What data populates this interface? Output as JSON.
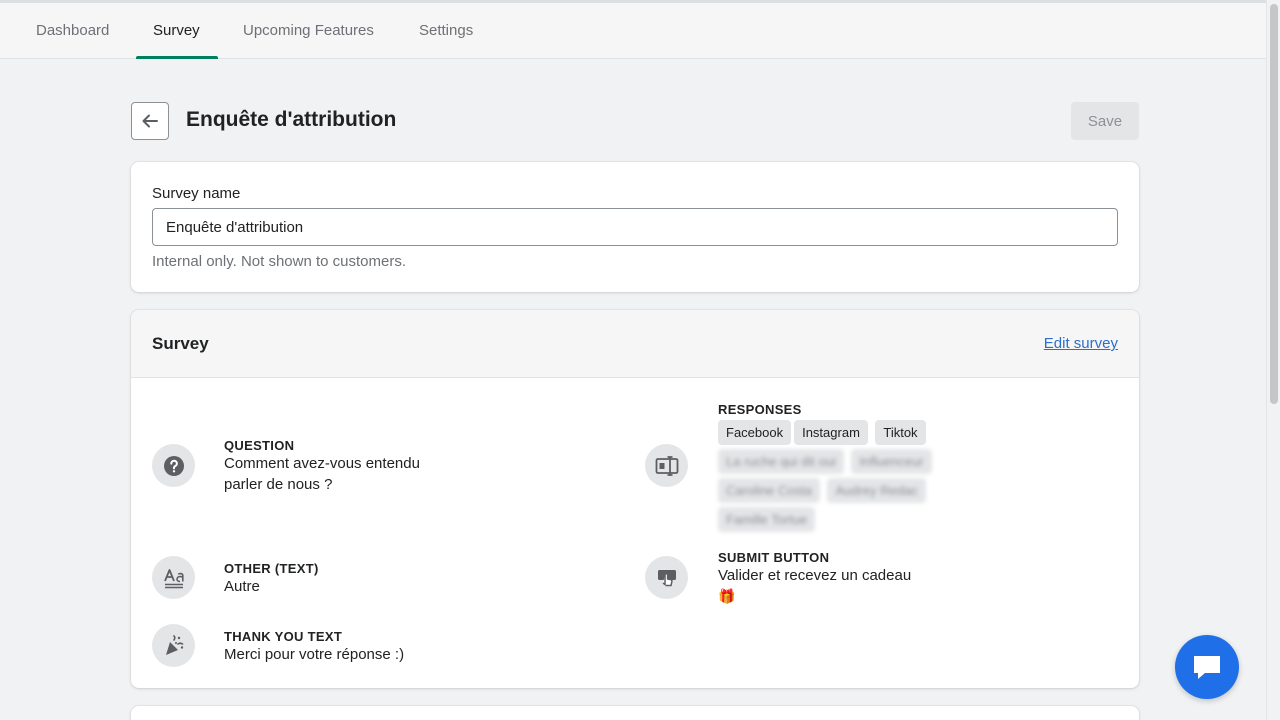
{
  "tabs": [
    {
      "label": "Dashboard"
    },
    {
      "label": "Survey"
    },
    {
      "label": "Upcoming Features"
    },
    {
      "label": "Settings"
    }
  ],
  "active_tab": "Survey",
  "header": {
    "title": "Enquête d'attribution",
    "save_label": "Save"
  },
  "name_card": {
    "label": "Survey name",
    "value": "Enquête d'attribution",
    "help": "Internal only. Not shown to customers."
  },
  "survey_card": {
    "title": "Survey",
    "edit_link": "Edit survey",
    "question": {
      "label": "QUESTION",
      "line1": "Comment avez-vous entendu",
      "line2": "parler de nous ?"
    },
    "responses": {
      "label": "RESPONSES",
      "chips": [
        "Facebook",
        "Instagram",
        "Tiktok",
        "La ruche qui dit oui",
        "Influenceur",
        "Caroline Costa",
        "Audrey Redac",
        "Famille Tortue"
      ]
    },
    "other": {
      "label": "OTHER (TEXT)",
      "value": "Autre"
    },
    "submit": {
      "label": "SUBMIT BUTTON",
      "line1": "Valider et recevez un cadeau",
      "emoji": "🎁"
    },
    "thank_you": {
      "label": "THANK YOU TEXT",
      "value": "Merci pour votre réponse :)"
    }
  },
  "colors": {
    "accent": "#008060",
    "link": "#2c6ecb",
    "chat": "#1f6fe8"
  },
  "icons": [
    "arrow-left-icon",
    "question-circle-icon",
    "text-icon",
    "confetti-icon",
    "list-select-icon",
    "button-press-icon",
    "chat-icon"
  ]
}
